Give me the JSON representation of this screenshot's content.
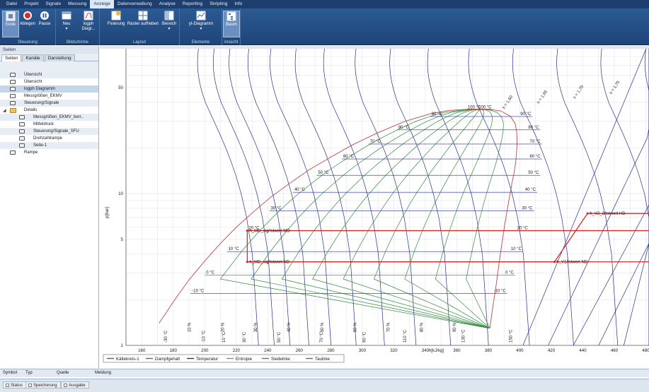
{
  "menu": [
    "Datei",
    "Projekt",
    "Signale",
    "Messung",
    "Anzeige",
    "Datenverwaltung",
    "Analyse",
    "Reporting",
    "Skripting",
    "Info"
  ],
  "menu_active": "Anzeige",
  "ribbon": {
    "steuerung": {
      "label": "Steuerung",
      "buttons": [
        "Ende",
        "Ablegen",
        "Pause"
      ]
    },
    "bildschirme": {
      "label": "Bildschirme",
      "buttons": [
        "Neu",
        "logph Diagr..."
      ]
    },
    "layout": {
      "label": "Layout",
      "buttons": [
        "Fixierung",
        "Raster aufheben",
        "Bereich"
      ]
    },
    "elemente": {
      "label": "Elemente",
      "buttons": [
        "yt-Diagramm"
      ]
    },
    "ansicht": {
      "label": "Ansicht",
      "buttons": [
        "Baum"
      ]
    }
  },
  "left": {
    "title": "Seiten",
    "tabs": [
      "Seiten",
      "Kanäle",
      "Darstellung"
    ],
    "tree": [
      {
        "label": "Übersicht",
        "indent": 1,
        "icon": "page-icon",
        "style": "alt"
      },
      {
        "label": "Übersicht",
        "indent": 1,
        "icon": "page-icon",
        "style": ""
      },
      {
        "label": "logph Diagramm",
        "indent": 1,
        "icon": "page-icon",
        "style": "sel"
      },
      {
        "label": "Messgrößen_EKMV",
        "indent": 1,
        "icon": "page-icon",
        "style": ""
      },
      {
        "label": "Steuerung/Signale",
        "indent": 1,
        "icon": "page-icon",
        "style": "alt"
      },
      {
        "label": "Details",
        "indent": 1,
        "icon": "folder-icon",
        "style": "",
        "expander": "◢"
      },
      {
        "label": "Messgrößen_EKMV_berr..",
        "indent": 2,
        "icon": "page-icon",
        "style": "alt"
      },
      {
        "label": "Mitteldruck",
        "indent": 2,
        "icon": "page-icon",
        "style": ""
      },
      {
        "label": "Steuerung/Signale_SFU",
        "indent": 2,
        "icon": "page-icon",
        "style": "alt"
      },
      {
        "label": "Drehzahlrampe",
        "indent": 2,
        "icon": "page-icon",
        "style": ""
      },
      {
        "label": "Seite-1",
        "indent": 2,
        "icon": "page-icon",
        "style": "alt"
      },
      {
        "label": "Rampe",
        "indent": 1,
        "icon": "page-icon",
        "style": ""
      }
    ]
  },
  "chart_data": {
    "type": "line",
    "title": "",
    "xlabel": "h[kJ/kg]",
    "ylabel": "p[bar]",
    "xlim": [
      150,
      480
    ],
    "ylim_log": [
      1,
      90
    ],
    "y_scale": "log",
    "x_ticks": [
      160,
      180,
      200,
      220,
      240,
      260,
      280,
      300,
      320,
      340,
      360,
      380,
      400,
      420,
      440,
      460,
      480
    ],
    "y_ticks": [
      1,
      5,
      10,
      50
    ],
    "grid": true,
    "legend_position": "bottom",
    "legend": [
      {
        "name": "Kältekreis-1",
        "color": "#d42a2a"
      },
      {
        "name": "Dampfgehalt",
        "color": "#2e8b3a"
      },
      {
        "name": "Temperatur",
        "color": "#2a2f8a"
      },
      {
        "name": "Entropie",
        "color": "#8a8a8a"
      },
      {
        "name": "Siedelinie",
        "color": "#c04848"
      },
      {
        "name": "Taulinie",
        "color": "#c04848"
      }
    ],
    "dome_left": [
      [
        171,
        1.4
      ],
      [
        181,
        2.0
      ],
      [
        190,
        2.7
      ],
      [
        200,
        3.6
      ],
      [
        210,
        4.7
      ],
      [
        220,
        6.0
      ],
      [
        231,
        7.6
      ],
      [
        242,
        9.5
      ],
      [
        254,
        11.7
      ],
      [
        266,
        14.3
      ],
      [
        280,
        17.4
      ],
      [
        294,
        21.0
      ],
      [
        310,
        25.2
      ],
      [
        327,
        29.9
      ],
      [
        343,
        33.5
      ],
      [
        355,
        35.3
      ],
      [
        368,
        36.0
      ],
      [
        380,
        36.0
      ]
    ],
    "dome_right": [
      [
        380,
        36.0
      ],
      [
        388,
        35.0
      ],
      [
        394,
        32.3
      ],
      [
        397,
        29.0
      ],
      [
        398,
        25.5
      ],
      [
        398.3,
        22.5
      ],
      [
        398,
        19.3
      ],
      [
        397.5,
        16.5
      ],
      [
        396.5,
        14.0
      ],
      [
        395,
        11.7
      ],
      [
        393.5,
        9.6
      ],
      [
        392,
        7.8
      ],
      [
        390.5,
        6.3
      ],
      [
        389,
        5.0
      ],
      [
        387.5,
        3.9
      ],
      [
        386,
        3.0
      ],
      [
        384.5,
        2.3
      ],
      [
        382.5,
        1.7
      ],
      [
        381,
        1.3
      ]
    ],
    "isotherms": [
      {
        "label": "-10 °C",
        "p": 2.2,
        "h_left": 191,
        "h_right": 392
      },
      {
        "label": "0 °C",
        "p": 2.9,
        "h_left": 200,
        "h_right": 397
      },
      {
        "label": "10 °C",
        "p": 4.15,
        "h_left": 214,
        "h_right": 402
      },
      {
        "label": "20 °C",
        "p": 5.7,
        "h_left": 227,
        "h_right": 406
      },
      {
        "label": "30 °C",
        "p": 7.7,
        "h_left": 241,
        "h_right": 409
      },
      {
        "label": "40 °C",
        "p": 10.2,
        "h_left": 256,
        "h_right": 411
      },
      {
        "label": "50 °C",
        "p": 13.2,
        "h_left": 271,
        "h_right": 413
      },
      {
        "label": "60 °C",
        "p": 16.9,
        "h_left": 287,
        "h_right": 414
      },
      {
        "label": "70 °C",
        "p": 21.2,
        "h_left": 304,
        "h_right": 414
      },
      {
        "label": "80 °C",
        "p": 26.3,
        "h_left": 322,
        "h_right": 413
      },
      {
        "label": "90 °C",
        "p": 32.2,
        "h_left": 343,
        "h_right": 408
      },
      {
        "label": "100 °C",
        "p": 35.6,
        "h_left": 366,
        "h_right": 383
      }
    ],
    "quality_labels": [
      "10 %",
      "20 %",
      "30 %",
      "40 %",
      "50 %",
      "60 %",
      "70 %",
      "80 %",
      "90 %"
    ],
    "bottom_temp_labels": [
      "-30 °C",
      "-10 °C",
      "10 °C",
      "30 °C",
      "50 °C",
      "70 °C",
      "90 °C",
      "110 °C",
      "130 °C",
      "150 °C"
    ],
    "entropy_labels": [
      "s = 1,60",
      "s = 1,65",
      "s = 1,70",
      "s = 1,75"
    ],
    "cycle": {
      "points": [
        {
          "label": "h_MD_sig/Istwert MD",
          "h": 227,
          "p": 5.7
        },
        {
          "label": "h_MD_sig/Istwert ND",
          "h": 227,
          "p": 3.55
        },
        {
          "label": "h_V1/Istwert ND",
          "h": 422,
          "p": 3.55
        },
        {
          "label": "h_V2_2/Istwert HD",
          "h": 443,
          "p": 7.4
        }
      ],
      "h_right_edge": 482
    }
  },
  "messages": {
    "cols": [
      "Symbol",
      "Typ",
      "Quelle",
      "Meldung"
    ]
  },
  "status_tabs": [
    "Status",
    "Speicherung",
    "Ausgabe"
  ],
  "colors": {
    "accent": "#1e3f6e",
    "cycle": "#d42a2a",
    "quality": "#2e8b3a",
    "isotherm": "#2a2f8a",
    "dome": "#c04848"
  }
}
